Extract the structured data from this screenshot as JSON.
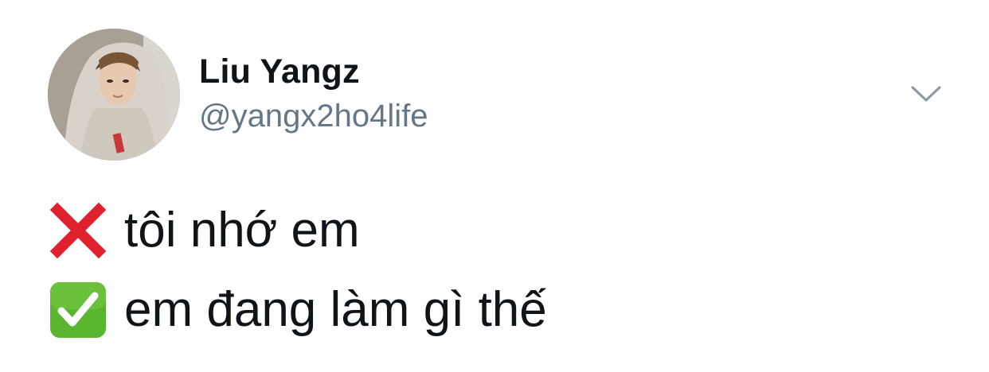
{
  "tweet": {
    "author": {
      "display_name": "Liu Yangz",
      "handle": "@yangx2ho4life",
      "avatar_icon": "profile-photo"
    },
    "menu_icon": "chevron-down-icon",
    "lines": [
      {
        "icon": "cross-mark-icon",
        "icon_color": "#e0202c",
        "text": "tôi nhớ em"
      },
      {
        "icon": "check-mark-button-icon",
        "icon_color": "#5ab52f",
        "text": "em đang làm gì thế"
      }
    ]
  },
  "colors": {
    "name": "#0f1419",
    "handle": "#657786",
    "caret": "#8899a6",
    "background": "#ffffff"
  }
}
